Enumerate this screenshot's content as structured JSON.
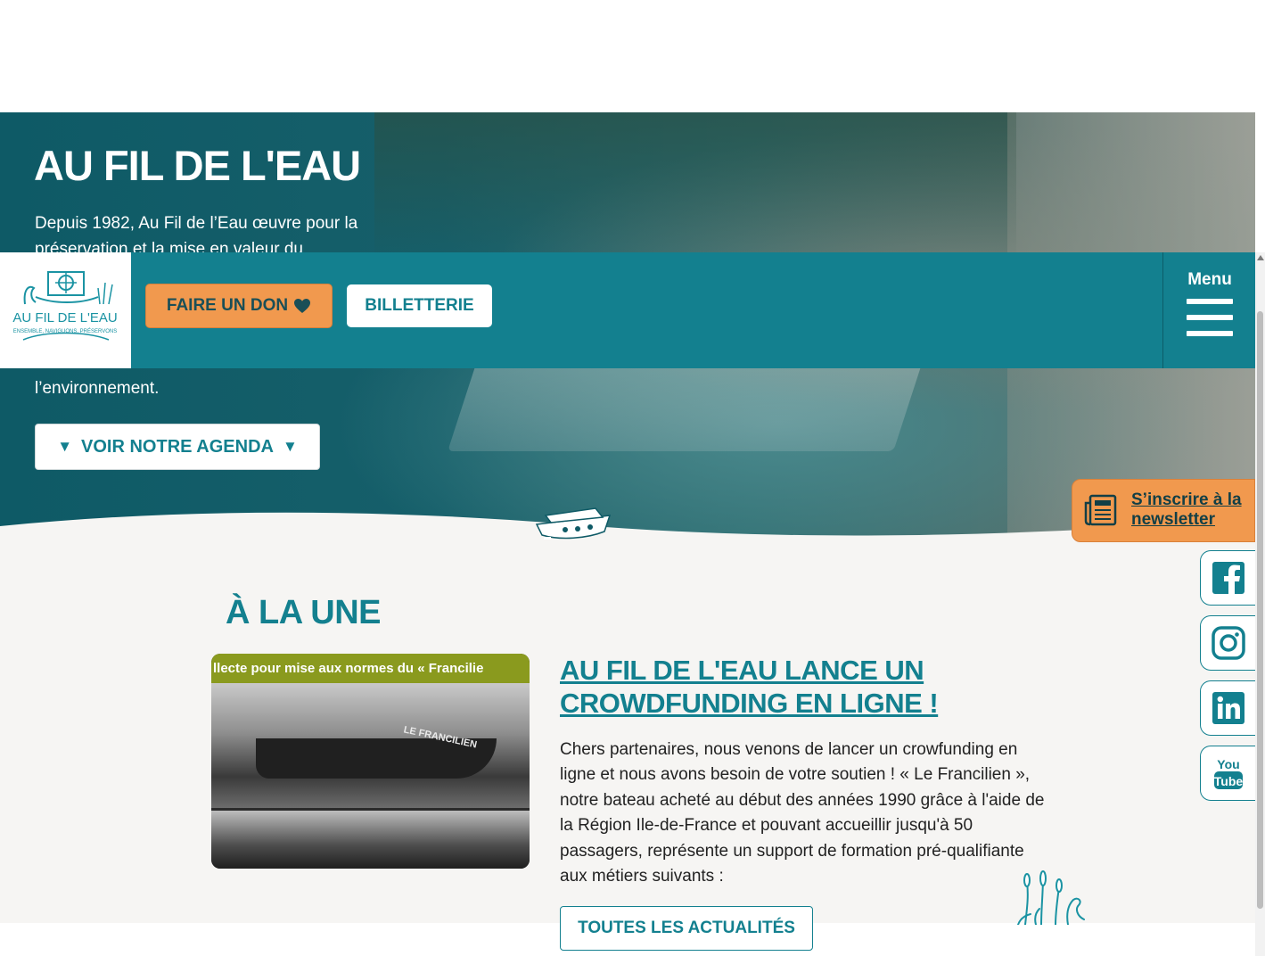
{
  "hero": {
    "title": "AU FIL DE L'EAU",
    "text": "Depuis 1982, Au Fil de l’Eau œuvre pour la préservation et la mise en valeur du",
    "text_tail": "l’environnement.",
    "agenda_label": "VOIR NOTRE AGENDA",
    "agenda_arrow": "▼"
  },
  "nav": {
    "logo_alt": "Au Fil de l'Eau",
    "logo_title": "AU FIL DE L'EAU",
    "logo_tagline": "ENSEMBLE, NAVIGUONS, PRÉSERVONS",
    "donate_label": "FAIRE UN DON",
    "tickets_label": "BILLETTERIE",
    "menu_label": "Menu"
  },
  "news": {
    "section_title": "À LA UNE",
    "image_banner": "llecte pour mise aux normes du « Francilie",
    "image_hull_text": "LE FRANCILIEN",
    "article_title": "AU FIL DE L'EAU LANCE UN CROWDFUNDING EN LIGNE !",
    "article_body": "Chers partenaires, nous venons de lancer un crowfunding en ligne et nous avons besoin de votre soutien ! « Le Francilien », notre bateau acheté au début des années 1990 grâce à l'aide de la Région Ile-de-France et pouvant accueillir jusqu'à 50 passagers, représente un support de formation pré-qualifiante aux métiers suivants :",
    "all_news_label": "TOUTES LES ACTUALITÉS"
  },
  "newsletter": {
    "label": "S’inscrire à la newsletter"
  },
  "social": {
    "items": [
      "facebook",
      "instagram",
      "linkedin",
      "youtube"
    ],
    "youtube_you": "You",
    "youtube_tube": "Tube"
  },
  "colors": {
    "teal": "#13808f",
    "orange": "#f1994e",
    "content_bg": "#f6f5f3"
  }
}
